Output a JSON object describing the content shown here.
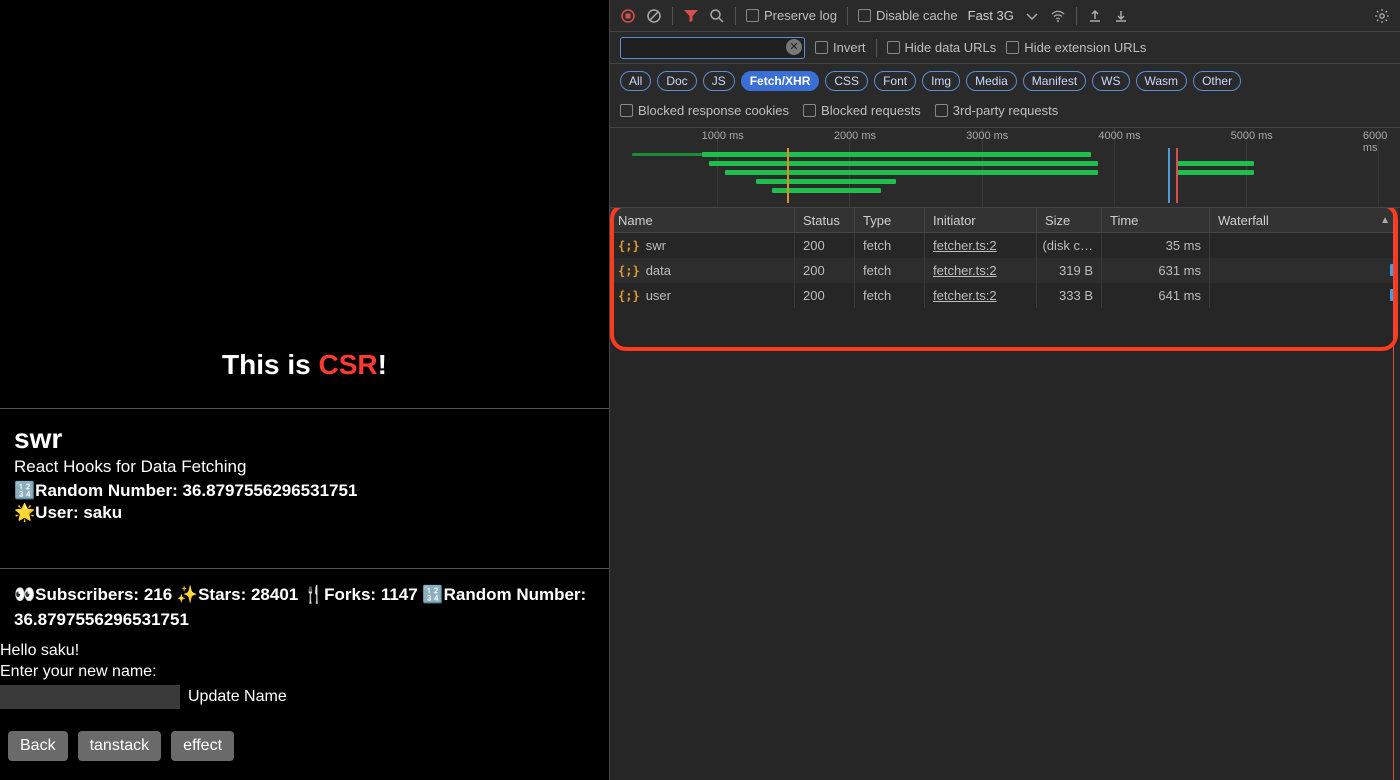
{
  "app": {
    "title_prefix": "This is ",
    "title_highlight": "CSR",
    "title_suffix": "!",
    "swr_title": "swr",
    "swr_subtitle": "React Hooks for Data Fetching",
    "random_line": "🔢Random Number: 36.8797556296531751",
    "user_line": "🌟User: saku",
    "metrics": "👀Subscribers: 216 ✨Stars: 28401 🍴Forks: 1147 🔢Random Number: 36.8797556296531751",
    "hello": "Hello saku!",
    "enter_label": "Enter your new name:",
    "update_label": "Update Name",
    "buttons": {
      "back": "Back",
      "tanstack": "tanstack",
      "effect": "effect"
    }
  },
  "toolbar": {
    "preserve_log": "Preserve log",
    "disable_cache": "Disable cache",
    "throttle": "Fast 3G"
  },
  "filters": {
    "invert": "Invert",
    "hide_data_urls": "Hide data URLs",
    "hide_ext_urls": "Hide extension URLs",
    "blocked_cookies": "Blocked response cookies",
    "blocked_requests": "Blocked requests",
    "third_party": "3rd-party requests",
    "pills": [
      "All",
      "Doc",
      "JS",
      "Fetch/XHR",
      "CSS",
      "Font",
      "Img",
      "Media",
      "Manifest",
      "WS",
      "Wasm",
      "Other"
    ],
    "active_pill": "Fetch/XHR"
  },
  "timeline": {
    "ticks": [
      "1000 ms",
      "2000 ms",
      "3000 ms",
      "4000 ms",
      "5000 ms",
      "6000 ms"
    ]
  },
  "table": {
    "headers": {
      "name": "Name",
      "status": "Status",
      "type": "Type",
      "initiator": "Initiator",
      "size": "Size",
      "time": "Time",
      "waterfall": "Waterfall"
    },
    "rows": [
      {
        "name": "swr",
        "status": "200",
        "type": "fetch",
        "initiator": "fetcher.ts:2",
        "size": "(disk c…",
        "time": "35 ms"
      },
      {
        "name": "data",
        "status": "200",
        "type": "fetch",
        "initiator": "fetcher.ts:2",
        "size": "319 B",
        "time": "631 ms"
      },
      {
        "name": "user",
        "status": "200",
        "type": "fetch",
        "initiator": "fetcher.ts:2",
        "size": "333 B",
        "time": "641 ms"
      }
    ]
  }
}
